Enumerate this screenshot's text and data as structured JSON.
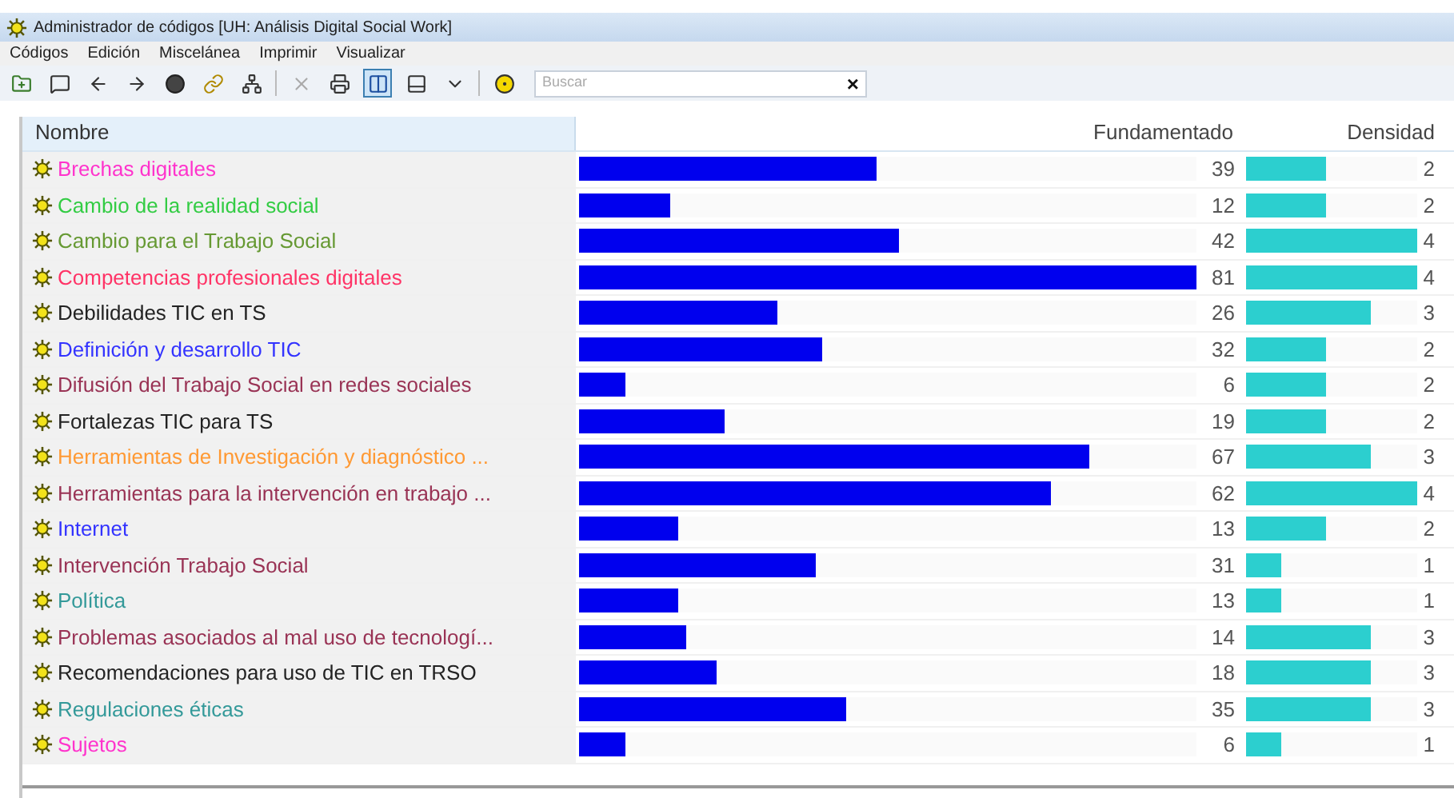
{
  "window": {
    "title": "Administrador de códigos [UH: Análisis Digital Social Work]"
  },
  "menu": [
    "Códigos",
    "Edición",
    "Miscelánea",
    "Imprimir",
    "Visualizar"
  ],
  "toolbar": [
    {
      "kind": "new-code"
    },
    {
      "kind": "comment"
    },
    {
      "kind": "back"
    },
    {
      "kind": "forward"
    },
    {
      "kind": "network"
    },
    {
      "kind": "link"
    },
    {
      "kind": "tree"
    },
    {
      "kind": "separator"
    },
    {
      "kind": "delete"
    },
    {
      "kind": "print"
    },
    {
      "kind": "split",
      "selected": true
    },
    {
      "kind": "pane",
      "selected": false
    },
    {
      "kind": "dropdown"
    },
    {
      "kind": "separator"
    },
    {
      "kind": "filter"
    }
  ],
  "search": {
    "placeholder": "Buscar",
    "clear": "×"
  },
  "table": {
    "columns": [
      "Nombre",
      "Fundamentado",
      "Densidad"
    ],
    "rows": [
      {
        "name": "Brechas digitales",
        "color": "#ff33cc",
        "grounded": {
          "value": "39",
          "level": 0.481
        },
        "density": {
          "value": "2",
          "level": 0.47
        }
      },
      {
        "name": "Cambio de la realidad social",
        "color": "#33cc44",
        "grounded": {
          "value": "12",
          "level": 0.148
        },
        "density": {
          "value": "2",
          "level": 0.47
        }
      },
      {
        "name": "Cambio para el Trabajo Social",
        "color": "#669933",
        "grounded": {
          "value": "42",
          "level": 0.519
        },
        "density": {
          "value": "4",
          "level": 1
        }
      },
      {
        "name": "Competencias profesionales digitales",
        "color": "#ff3366",
        "grounded": {
          "value": "81",
          "level": 1
        },
        "density": {
          "value": "4",
          "level": 1
        }
      },
      {
        "name": "Debilidades TIC en TS",
        "color": "#222222",
        "grounded": {
          "value": "26",
          "level": 0.321
        },
        "density": {
          "value": "3",
          "level": 0.73
        }
      },
      {
        "name": "Definición y desarrollo TIC",
        "color": "#3333ff",
        "grounded": {
          "value": "32",
          "level": 0.395
        },
        "density": {
          "value": "2",
          "level": 0.47
        }
      },
      {
        "name": "Difusión del Trabajo Social en redes sociales",
        "color": "#993355",
        "grounded": {
          "value": "6",
          "level": 0.074
        },
        "density": {
          "value": "2",
          "level": 0.47
        }
      },
      {
        "name": "Fortalezas TIC para TS",
        "color": "#222222",
        "grounded": {
          "value": "19",
          "level": 0.235
        },
        "density": {
          "value": "2",
          "level": 0.47
        }
      },
      {
        "name": "Herramientas de Investigación y diagnóstico ...",
        "color": "#ff9933",
        "grounded": {
          "value": "67",
          "level": 0.827
        },
        "density": {
          "value": "3",
          "level": 0.73
        }
      },
      {
        "name": "Herramientas para la intervención en trabajo ...",
        "color": "#993355",
        "grounded": {
          "value": "62",
          "level": 0.765
        },
        "density": {
          "value": "4",
          "level": 1
        }
      },
      {
        "name": "Internet",
        "color": "#3333ff",
        "grounded": {
          "value": "13",
          "level": 0.16
        },
        "density": {
          "value": "2",
          "level": 0.47
        }
      },
      {
        "name": "Intervención Trabajo Social",
        "color": "#993355",
        "grounded": {
          "value": "31",
          "level": 0.383
        },
        "density": {
          "value": "1",
          "level": 0.21
        }
      },
      {
        "name": "Política",
        "color": "#339999",
        "grounded": {
          "value": "13",
          "level": 0.16
        },
        "density": {
          "value": "1",
          "level": 0.21
        }
      },
      {
        "name": "Problemas asociados al mal uso de tecnologí...",
        "color": "#993355",
        "grounded": {
          "value": "14",
          "level": 0.173
        },
        "density": {
          "value": "3",
          "level": 0.73
        }
      },
      {
        "name": "Recomendaciones para uso de TIC en TRSO",
        "color": "#222222",
        "grounded": {
          "value": "18",
          "level": 0.222
        },
        "density": {
          "value": "3",
          "level": 0.73
        }
      },
      {
        "name": "Regulaciones éticas",
        "color": "#339999",
        "grounded": {
          "value": "35",
          "level": 0.432
        },
        "density": {
          "value": "3",
          "level": 0.73
        }
      },
      {
        "name": "Sujetos",
        "color": "#ff33cc",
        "grounded": {
          "value": "6",
          "level": 0.074
        },
        "density": {
          "value": "1",
          "level": 0.21
        }
      }
    ]
  }
}
